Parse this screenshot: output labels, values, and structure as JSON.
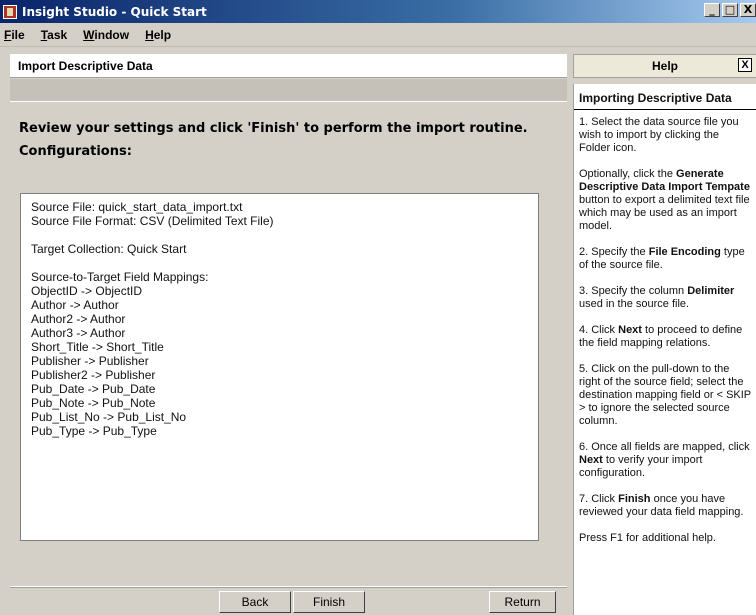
{
  "window": {
    "title": "Insight Studio - Quick Start",
    "controls": [
      "_",
      "□",
      "X"
    ]
  },
  "menu": [
    "File",
    "Task",
    "Window",
    "Help"
  ],
  "main": {
    "header": "Import Descriptive Data",
    "instruction": "Review your settings and click 'Finish' to perform the import routine.",
    "config_label": "Configurations:",
    "config_lines": [
      "Source File: quick_start_data_import.txt",
      "Source File Format: CSV (Delimited Text File)",
      "",
      "Target Collection: Quick Start",
      "",
      "Source-to-Target Field Mappings:",
      "ObjectID -> ObjectID",
      "Author -> Author",
      "Author2 -> Author",
      "Author3 -> Author",
      "Short_Title -> Short_Title",
      "Publisher -> Publisher",
      "Publisher2 -> Publisher",
      "Pub_Date -> Pub_Date",
      "Pub_Note -> Pub_Note",
      "Pub_List_No -> Pub_List_No",
      "Pub_Type -> Pub_Type"
    ],
    "buttons": {
      "back": "Back",
      "finish": "Finish",
      "return": "Return"
    }
  },
  "help": {
    "header": "Help",
    "close": "X",
    "title": "Importing Descriptive Data",
    "steps": [
      {
        "pre": "1. Select the data source file you wish to import by clicking the Folder icon.",
        "bold": "",
        "post": ""
      },
      {
        "pre": "Optionally, click the ",
        "bold": "Generate Descriptive Data Import Tempate",
        "post": " button to export a delimited text file which may be used as an import model."
      },
      {
        "pre": "2. Specify the ",
        "bold": "File Encoding",
        "post": " type of the source file."
      },
      {
        "pre": "3. Specify the column ",
        "bold": "Delimiter",
        "post": " used in the source file."
      },
      {
        "pre": "4. Click ",
        "bold": "Next",
        "post": " to proceed to define the field mapping relations."
      },
      {
        "pre": "5. Click on the pull-down to the right of the source field; select the destination mapping field or < SKIP > to ignore the selected source column.",
        "bold": "",
        "post": ""
      },
      {
        "pre": "6. Once all fields are mapped, click ",
        "bold": "Next",
        "post": " to verify your import configuration."
      },
      {
        "pre": "7. Click ",
        "bold": "Finish",
        "post": " once you have reviewed your data field mapping."
      },
      {
        "pre": "Press F1 for additional help.",
        "bold": "",
        "post": ""
      }
    ]
  }
}
